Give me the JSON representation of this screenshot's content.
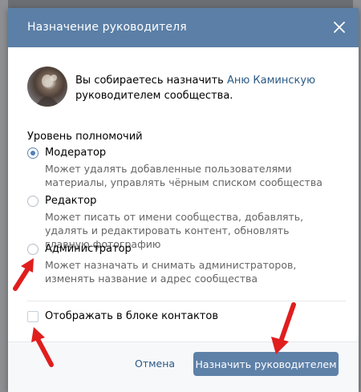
{
  "dialog": {
    "title": "Назначение руководителя",
    "close_icon": "close-icon"
  },
  "intro": {
    "text_before": "Вы собираетесь назначить ",
    "user_link": "Аню Каминскую",
    "text_after": "руководителем сообщества."
  },
  "permissions": {
    "title": "Уровень полномочий",
    "options": [
      {
        "label": "Модератор",
        "description": "Может удалять добавленные пользователями материалы, управлять чёрным списком сообщества",
        "selected": true
      },
      {
        "label": "Редактор",
        "description": "Может писать от имени сообщества, добавлять, удалять и редактировать контент, обновлять главную фотографию",
        "selected": false
      },
      {
        "label": "Администратор",
        "description": "Может назначать и снимать администраторов, изменять название и адрес сообщества",
        "selected": false
      }
    ]
  },
  "contacts_checkbox": {
    "label": "Отображать в блоке контактов",
    "checked": false
  },
  "footer": {
    "cancel_label": "Отмена",
    "submit_label": "Назначить руководителем"
  },
  "colors": {
    "header_bg": "#5b7fa6",
    "primary_button": "#5e81a8",
    "link": "#2a5885",
    "annotation_arrow": "#e01e1e"
  }
}
